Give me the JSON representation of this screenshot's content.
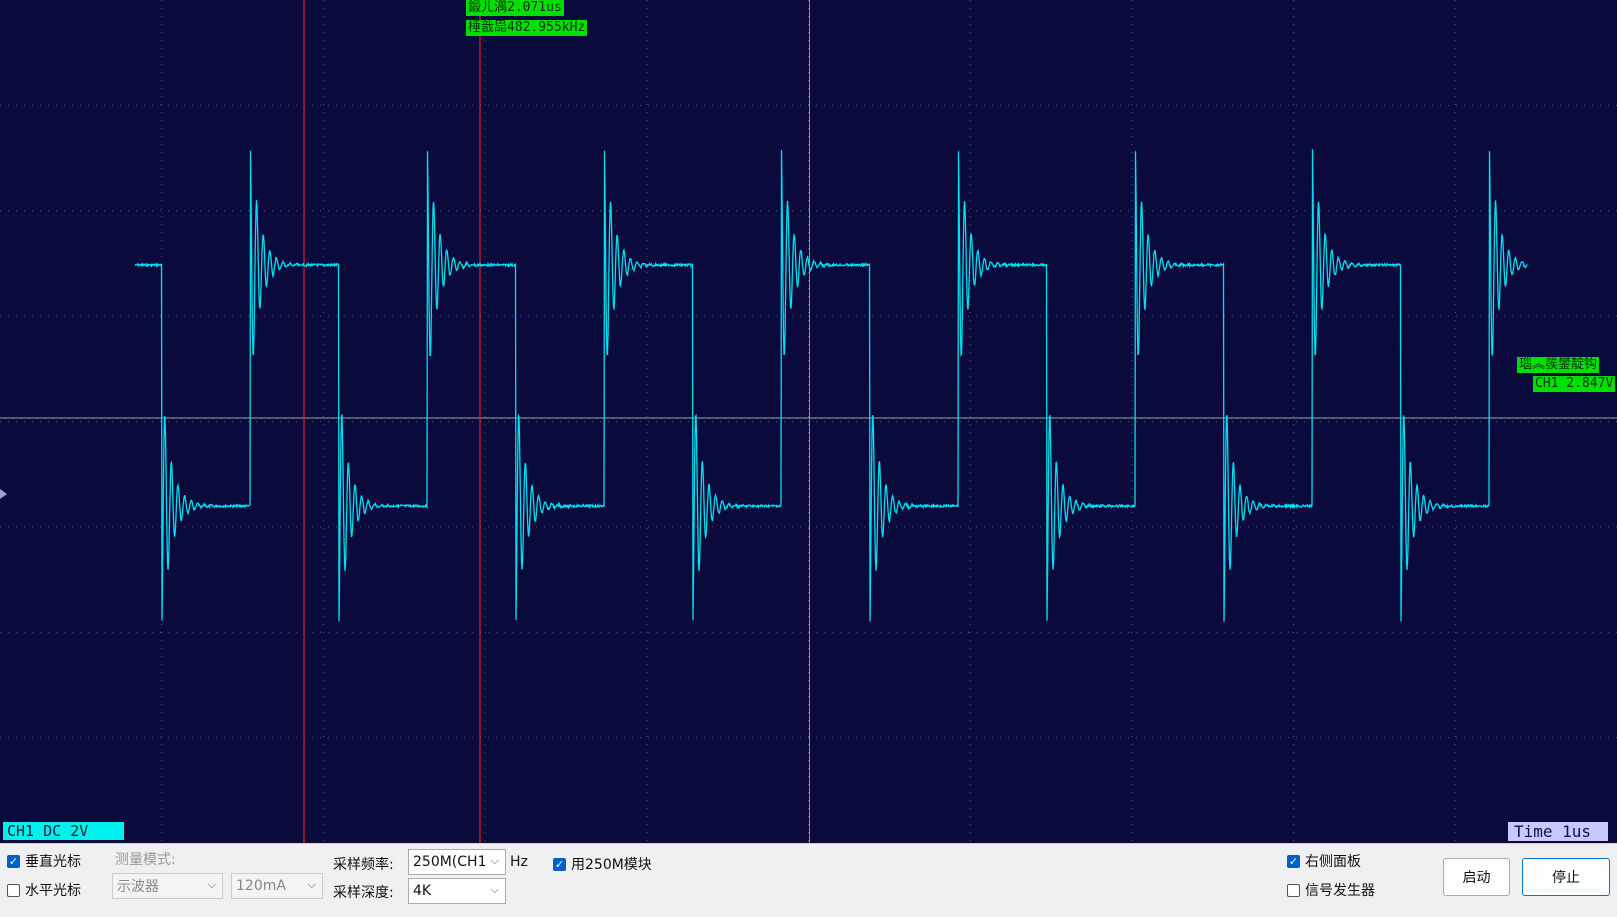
{
  "scope": {
    "cursor_time_label": "鍛ㄦ湡2.071us",
    "cursor_freq_label": "棰戠巼482.955kHz",
    "trigger_label_top": "瑙︽彂鐢靛钩",
    "trigger_label_bottom": "CH1 2.847V",
    "channel_info": "CH1 DC    2V",
    "time_info": "Time  1us",
    "trace_color": "#00e0f0",
    "grid_color": "#4a5a8a",
    "cursor_color": "#e02020",
    "background_color": "#0a0a3c"
  },
  "controls": {
    "vertical_cursor": {
      "label": "垂直光标",
      "checked": true
    },
    "horizontal_cursor": {
      "label": "水平光标",
      "checked": false
    },
    "measure_mode_label": "测量模式:",
    "measure_mode_value": "示波器",
    "current_value": "120mA",
    "sample_rate_label": "采样频率:",
    "sample_rate_value": "250M(CH1",
    "sample_rate_unit": "Hz",
    "use_250m": {
      "label": "用250M模块",
      "checked": true
    },
    "sample_depth_label": "采样深度:",
    "sample_depth_value": "4K",
    "right_panel": {
      "label": "右侧面板",
      "checked": true
    },
    "signal_generator": {
      "label": "信号发生器",
      "checked": false
    },
    "start_label": "启动",
    "stop_label": "停止"
  }
}
